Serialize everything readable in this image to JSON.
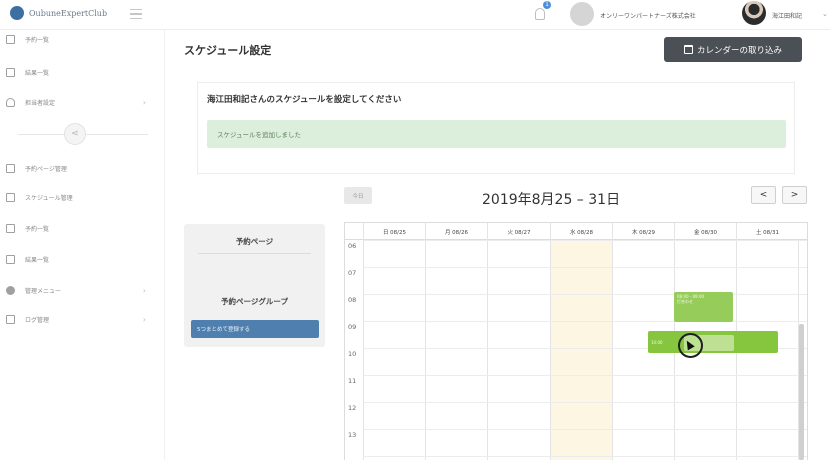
{
  "header": {
    "brand": "OubuneExpertClub",
    "notification_count": "1",
    "company_name": "オンリーワンパートナーズ株式会社",
    "user_name": "海江田和記"
  },
  "sidebar": {
    "items": [
      {
        "label": "予約一覧",
        "icon": "edit-icon"
      },
      {
        "label": "結果一覧",
        "icon": "document-icon"
      },
      {
        "label": "担当者設定",
        "icon": "person-icon"
      },
      {
        "label": "予約ページ管理",
        "icon": "page-icon"
      },
      {
        "label": "スケジュール管理",
        "icon": "calendar-icon"
      },
      {
        "label": "予約一覧",
        "icon": "edit-icon"
      },
      {
        "label": "結果一覧",
        "icon": "document-icon"
      },
      {
        "label": "管理メニュー",
        "icon": "gear-icon"
      },
      {
        "label": "ログ管理",
        "icon": "log-icon"
      }
    ]
  },
  "main": {
    "title": "スケジュール設定",
    "import_button": "カレンダーの取り込み",
    "panel_heading": "海江田和記さんのスケジュールを設定してください",
    "alert_text": "スケジュールを追加しました",
    "left_card": {
      "title1": "予約ページ",
      "title2": "予約ページグループ",
      "button": "5つまとめて登録する"
    }
  },
  "calendar": {
    "today_button": "今日",
    "range": "2019年8月25 – 31日",
    "prev": "<",
    "next": ">",
    "days": [
      "日 08/25",
      "月 08/26",
      "火 08/27",
      "水 08/28",
      "木 08/29",
      "金 08/30",
      "土 08/31"
    ],
    "hours": [
      "06",
      "07",
      "08",
      "09",
      "10",
      "11",
      "12",
      "13"
    ],
    "events": [
      {
        "time": "08:00 - 09:00",
        "title": "打合わせ"
      },
      {
        "time": "",
        "title": "10:00"
      }
    ]
  },
  "colors": {
    "primary_button": "#4b5057",
    "success_bg": "#dcefdc",
    "event_green": "#86c53e",
    "today_bg": "#fcf6e3",
    "group_button": "#4f7fae"
  }
}
